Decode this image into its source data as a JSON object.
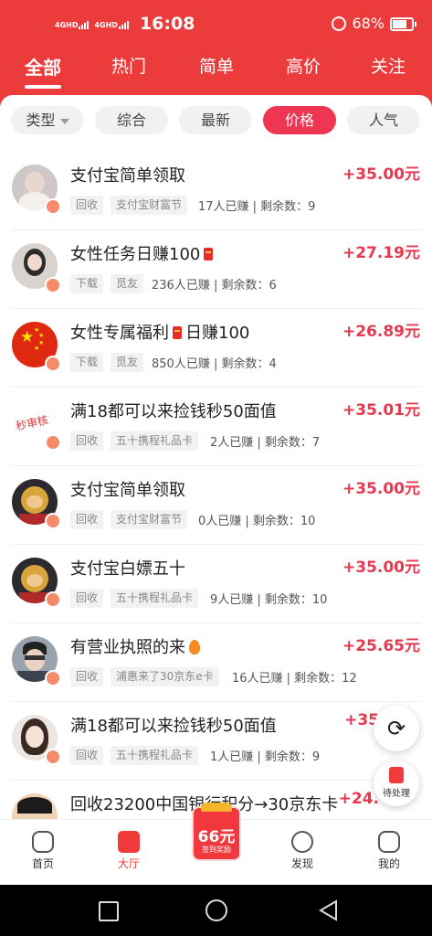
{
  "status_bar": {
    "network1": "4GHD",
    "network2": "4GHD",
    "time": "16:08",
    "battery": "68%"
  },
  "tabs": [
    {
      "label": "全部",
      "active": true
    },
    {
      "label": "热门"
    },
    {
      "label": "简单"
    },
    {
      "label": "高价"
    },
    {
      "label": "关注"
    }
  ],
  "filters": [
    {
      "label": "类型",
      "dropdown": true
    },
    {
      "label": "综合"
    },
    {
      "label": "最新"
    },
    {
      "label": "价格",
      "active": true
    },
    {
      "label": "人气"
    }
  ],
  "tasks": [
    {
      "title": "支付宝简单领取",
      "price": "+35.00元",
      "tags": [
        "回收",
        "支付宝财富节"
      ],
      "stats": "17人已赚 | 剩余数：9"
    },
    {
      "title": "女性任务日赚100",
      "price": "+27.19元",
      "tags": [
        "下载",
        "觅友"
      ],
      "stats": "236人已赚 | 剩余数：6"
    },
    {
      "title": "女性专属福利",
      "title_suffix": "日赚100",
      "price": "+26.89元",
      "tags": [
        "下载",
        "觅友"
      ],
      "stats": "850人已赚 | 剩余数：4"
    },
    {
      "title": "满18都可以来捡钱秒50面值",
      "price": "+35.01元",
      "tags": [
        "回收",
        "五十携程礼品卡"
      ],
      "stats": "2人已赚 | 剩余数：7",
      "avatar_text": "秒审核"
    },
    {
      "title": "支付宝简单领取",
      "price": "+35.00元",
      "tags": [
        "回收",
        "支付宝财富节"
      ],
      "stats": "0人已赚 | 剩余数：10"
    },
    {
      "title": "支付宝白嫖五十",
      "price": "+35.00元",
      "tags": [
        "回收",
        "五十携程礼品卡"
      ],
      "stats": "9人已赚 | 剩余数：10"
    },
    {
      "title": "有营业执照的来",
      "price": "+25.65元",
      "tags": [
        "回收",
        "浦惠来了30京东e卡"
      ],
      "stats": "16人已赚 | 剩余数：12"
    },
    {
      "title": "满18都可以来捡钱秒50面值",
      "price": "+35",
      "tags": [
        "回收",
        "五十携程礼品卡"
      ],
      "stats": "1人已赚 | 剩余数：9"
    },
    {
      "title": "回收23200中国银行积分→30京东卡",
      "price": "+24."
    }
  ],
  "fab": {
    "pending_label": "待处理"
  },
  "bottom_nav": [
    {
      "label": "首页"
    },
    {
      "label": "大厅",
      "active": true
    },
    {
      "label": "发现"
    },
    {
      "label": "我的"
    }
  ],
  "signin": {
    "amount": "66元",
    "label": "签到奖励"
  },
  "colors": {
    "brand": "#ec3b3b",
    "price": "#e63950",
    "active_chip": "#ee3552"
  }
}
